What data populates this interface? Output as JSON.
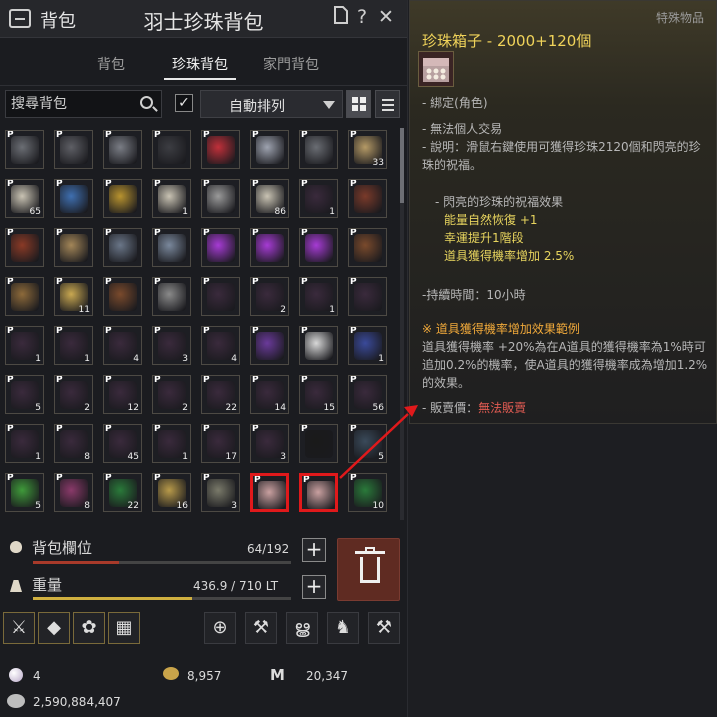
{
  "titlebar": {
    "bag_title": "背包",
    "main_title": "羽士珍珠背包",
    "help": "?",
    "close": "✕"
  },
  "tabs": [
    {
      "label": "背包"
    },
    {
      "label": "珍珠背包",
      "active": true
    },
    {
      "label": "家門背包"
    }
  ],
  "search": {
    "placeholder": "搜尋背包"
  },
  "sort": {
    "checked": "✓",
    "label": "自動排列"
  },
  "slots": [
    {
      "p": "P",
      "c": "",
      "col": "#6b6e74"
    },
    {
      "p": "P",
      "c": "",
      "col": "#5e5f65"
    },
    {
      "p": "P",
      "c": "",
      "col": "#7a7d85"
    },
    {
      "p": "P",
      "c": "",
      "col": "#3c3d42"
    },
    {
      "p": "P",
      "c": "",
      "col": "#c0303a"
    },
    {
      "p": "P",
      "c": "",
      "col": "#9ea3b0"
    },
    {
      "p": "P",
      "c": "",
      "col": "#6a6d73"
    },
    {
      "p": "P",
      "c": "33",
      "col": "#b59a66"
    },
    {
      "p": "P",
      "c": "65",
      "col": "#c9c3b3"
    },
    {
      "p": "P",
      "c": "",
      "col": "#3f6fb0"
    },
    {
      "p": "P",
      "c": "",
      "col": "#b8932f"
    },
    {
      "p": "P",
      "c": "1",
      "col": "#c9c3b3"
    },
    {
      "p": "P",
      "c": "",
      "col": "#9a9a9a"
    },
    {
      "p": "P",
      "c": "86",
      "col": "#c9c3b3"
    },
    {
      "p": "P",
      "c": "1",
      "col": "#3a2a3c"
    },
    {
      "p": "P",
      "c": "",
      "col": "#7a3a2a"
    },
    {
      "p": "P",
      "c": "",
      "col": "#8a3a26"
    },
    {
      "p": "P",
      "c": "",
      "col": "#a38658"
    },
    {
      "p": "P",
      "c": "",
      "col": "#6a7688"
    },
    {
      "p": "P",
      "c": "",
      "col": "#7a889c"
    },
    {
      "p": "P",
      "c": "",
      "col": "#a63bd4"
    },
    {
      "p": "P",
      "c": "",
      "col": "#a63bd4"
    },
    {
      "p": "P",
      "c": "",
      "col": "#a63bd4"
    },
    {
      "p": "P",
      "c": "",
      "col": "#7a4a2c"
    },
    {
      "p": "P",
      "c": "",
      "col": "#8d6a3a"
    },
    {
      "p": "P",
      "c": "11",
      "col": "#c9a851"
    },
    {
      "p": "P",
      "c": "",
      "col": "#7a4a2c"
    },
    {
      "p": "P",
      "c": "",
      "col": "#8a8a8a"
    },
    {
      "p": "P",
      "c": "",
      "col": "#3a2a3c"
    },
    {
      "p": "P",
      "c": "2",
      "col": "#3a2a3c"
    },
    {
      "p": "P",
      "c": "1",
      "col": "#3a2a3c"
    },
    {
      "p": "P",
      "c": "",
      "col": "#3a2a3c"
    },
    {
      "p": "P",
      "c": "1",
      "col": "#3a2a3c"
    },
    {
      "p": "P",
      "c": "1",
      "col": "#3a2a3c"
    },
    {
      "p": "P",
      "c": "4",
      "col": "#3a2a3c"
    },
    {
      "p": "P",
      "c": "3",
      "col": "#3a2a3c"
    },
    {
      "p": "P",
      "c": "4",
      "col": "#3a2a3c"
    },
    {
      "p": "P",
      "c": "",
      "col": "#6a3a9a"
    },
    {
      "p": "P",
      "c": "",
      "col": "#d8d8d8"
    },
    {
      "p": "P",
      "c": "1",
      "col": "#3a4a9a"
    },
    {
      "p": "P",
      "c": "5",
      "col": "#3a2a3c"
    },
    {
      "p": "P",
      "c": "2",
      "col": "#3a2a3c"
    },
    {
      "p": "P",
      "c": "12",
      "col": "#3a2a3c"
    },
    {
      "p": "P",
      "c": "2",
      "col": "#3a2a3c"
    },
    {
      "p": "P",
      "c": "22",
      "col": "#3a2a3c"
    },
    {
      "p": "P",
      "c": "14",
      "col": "#3a2a3c"
    },
    {
      "p": "P",
      "c": "15",
      "col": "#3a2a3c"
    },
    {
      "p": "P",
      "c": "56",
      "col": "#3a2a3c"
    },
    {
      "p": "P",
      "c": "1",
      "col": "#3a2a3c"
    },
    {
      "p": "P",
      "c": "8",
      "col": "#3a2a3c"
    },
    {
      "p": "P",
      "c": "45",
      "col": "#3a2a3c"
    },
    {
      "p": "P",
      "c": "1",
      "col": "#3a2a3c"
    },
    {
      "p": "P",
      "c": "17",
      "col": "#3a2a3c"
    },
    {
      "p": "P",
      "c": "3",
      "col": "#3a2a3c"
    },
    {
      "p": "P",
      "c": "",
      "col": "#1a1a1a"
    },
    {
      "p": "P",
      "c": "5",
      "col": "#3a4a5a"
    },
    {
      "p": "P",
      "c": "5",
      "col": "#3f9a3a"
    },
    {
      "p": "P",
      "c": "8",
      "col": "#8a3a6a"
    },
    {
      "p": "P",
      "c": "22",
      "col": "#2a7a3a"
    },
    {
      "p": "P",
      "c": "16",
      "col": "#b89a4a"
    },
    {
      "p": "P",
      "c": "3",
      "col": "#7a7a6a"
    },
    {
      "p": "P",
      "c": "",
      "col": "#c9a0a0",
      "sel": true
    },
    {
      "p": "P",
      "c": "",
      "col": "#c9a0a0",
      "sel": true
    },
    {
      "p": "P",
      "c": "10",
      "col": "#2a7a3a"
    }
  ],
  "capacity": {
    "label": "背包欄位",
    "value": "64/192",
    "fraction": 0.3333,
    "color": "#a83a2a"
  },
  "weight": {
    "label": "重量",
    "value": "436.9 / 710 LT",
    "fraction": 0.6154,
    "color": "#d0b040"
  },
  "actions": [
    {
      "icon": "sword-polish-icon",
      "g": "⚔"
    },
    {
      "icon": "gem-icon",
      "g": "◆"
    },
    {
      "icon": "pet-feed-icon",
      "g": "✿"
    },
    {
      "icon": "grid-icon",
      "g": "▦"
    },
    {
      "icon": "transfer-icon",
      "g": "⊕"
    },
    {
      "icon": "hammer-icon",
      "g": "⚒"
    },
    {
      "icon": "spiral-icon",
      "g": "ൠ"
    },
    {
      "icon": "wagon-icon",
      "g": "♞"
    },
    {
      "icon": "repair-icon",
      "g": "⚒"
    }
  ],
  "currency": {
    "pearl": "4",
    "gold": "8,957",
    "contrib": "20,347",
    "silver": "2,590,884,407"
  },
  "tooltip": {
    "special": "特殊物品",
    "name": "珍珠箱子 - 2000+120個",
    "bind": "- 綁定(角色)",
    "no_trade": "- 無法個人交易",
    "desc": "- 說明：滑鼠右鍵使用可獲得珍珠2120個和閃亮的珍珠的祝福。",
    "effect_title": "- 閃亮的珍珠的祝福效果",
    "effect1": "能量自然恢復 +1",
    "effect2": "幸運提升1階段",
    "effect3": "道具獲得機率增加 2.5%",
    "duration": "-持續時間：10小時",
    "note_title": "※ 道具獲得機率增加效果範例",
    "note_body": "道具獲得機率 +20%為在A道具的獲得機率為1%時可追加0.2%的機率，使A道具的獲得機率成為增加1.2%的效果。",
    "sell_label": "- 販賣價：",
    "sell_value": "無法販賣"
  }
}
